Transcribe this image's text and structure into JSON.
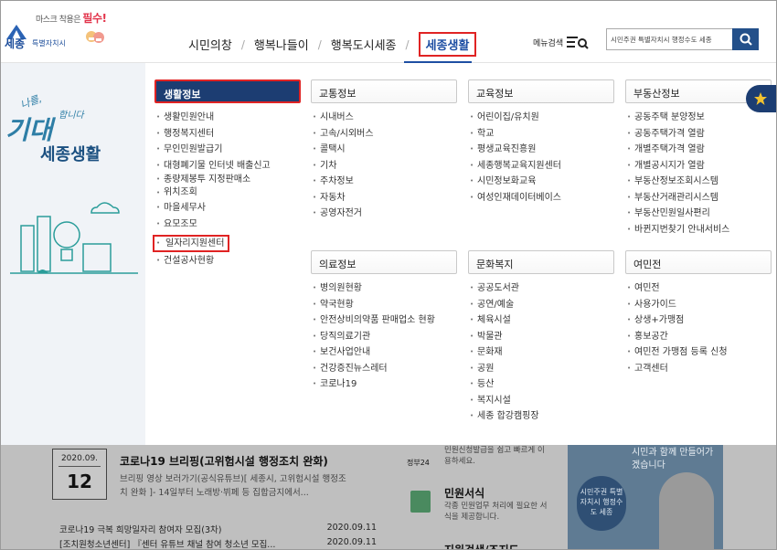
{
  "header": {
    "logo": {
      "tagline": "마스크 착용은",
      "tagline_em": "필수!",
      "name": "세종",
      "sub": "특별자치시"
    },
    "nav": [
      "시민의창",
      "행복나들이",
      "행복도시세종",
      "세종생활"
    ],
    "menu_search": "메뉴검색",
    "search_value": "시민주권 특별자치시 행정수도 세종",
    "colors": {
      "brand": "#1e4fa3",
      "highlight": "#e02323"
    }
  },
  "banner": {
    "s1": "나를,",
    "s2": "기대",
    "s3": "합니다",
    "s4": "세종생활"
  },
  "categories": [
    {
      "title": "생활정보",
      "items": [
        "생활민원안내",
        "행정복지센터",
        "무인민원발급기",
        "대형폐기물 인터넷 배출신고",
        "종량제봉투 지정판매소",
        "위치조회",
        "마을세무사",
        "요모조모",
        "일자리지원센터",
        "건설공사현황"
      ]
    },
    {
      "title": "교통정보",
      "items": [
        "시내버스",
        "고속/시외버스",
        "콜택시",
        "기차",
        "주차정보",
        "자동차",
        "공영자전거"
      ]
    },
    {
      "title": "교육정보",
      "items": [
        "어린이집/유치원",
        "학교",
        "평생교육진흥원",
        "세종행복교육지원센터",
        "시민정보화교육",
        "여성인재데이터베이스"
      ]
    },
    {
      "title": "부동산정보",
      "items": [
        "공동주택 분양정보",
        "공동주택가격 열람",
        "개별주택가격 열람",
        "개별공시지가 열람",
        "부동산정보조회시스템",
        "부동산거래관리시스템",
        "부동산민원일사편리",
        "바뀐지번찾기 안내서비스"
      ]
    },
    {
      "title": "의료정보",
      "items": [
        "병의원현황",
        "약국현황",
        "안전상비의약품 판매업소 현황",
        "당직의료기관",
        "보건사업안내",
        "건강증진뉴스레터",
        "코로나19"
      ]
    },
    {
      "title": "문화복지",
      "items": [
        "공공도서관",
        "공연/예술",
        "체육시설",
        "박물관",
        "문화재",
        "공원",
        "등산",
        "복지시설",
        "세종 합강캠핑장"
      ]
    },
    {
      "title": "여민전",
      "items": [
        "여민전",
        "사용가이드",
        "상생+가맹점",
        "홍보공간",
        "여민전 가맹점 등록 신청",
        "고객센터"
      ]
    }
  ],
  "bottom": {
    "date_ym": "2020.09.",
    "date_d": "12",
    "news_title": "코로나19 브리핑(고위험시설 행정조치 완화)",
    "news_desc": "브리핑 영상 보러가기(공식유튜브)[ 세종시, 고위험시설 행정조치 완화 ]- 14일부터 노래방·뷔페 등 집합금지에서...",
    "list": [
      {
        "t": "코로나19 극복 희망일자리 참여자 모집(3차)",
        "d": "2020.09.11"
      },
      {
        "t": "[조치원청소년센터] 『센터 유튜브 채널 참여 청소년 모집...",
        "d": "2020.09.11"
      }
    ],
    "gov": "정부24",
    "gov_desc": "민원신청발급을 쉽고 빠르게 이용하세요.",
    "forms_title": "민원서식",
    "forms_desc": "각종 민원업무 처리에 필요한 서식을 제공합니다.",
    "next_title": "지원검색/조지도",
    "promo_text": "시민과 함께 만들어가겠습니다",
    "promo_badge": "시민주권 특별자치시 행정수도 세종"
  }
}
